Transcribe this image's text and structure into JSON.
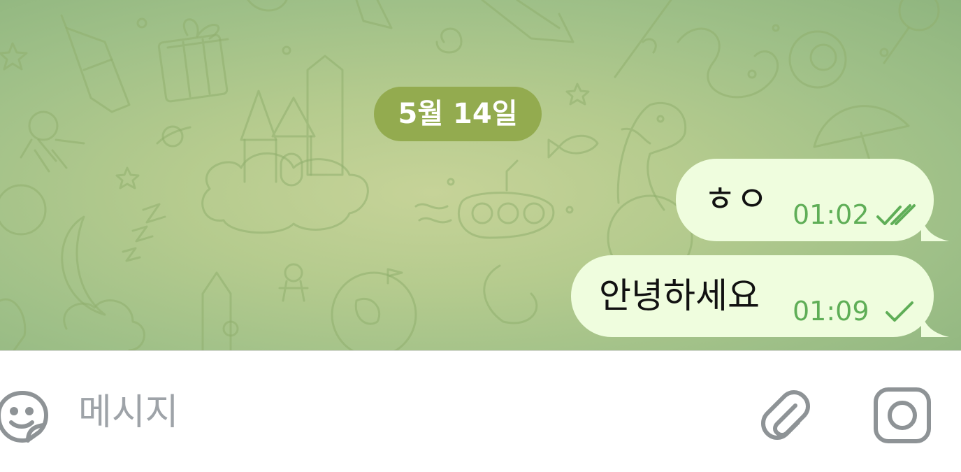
{
  "chat": {
    "date_label": "5월 14일",
    "messages": [
      {
        "text": "ㅎㅇ",
        "time": "01:02",
        "status_icon": "double-check-icon"
      },
      {
        "text": "안녕하세요",
        "time": "01:09",
        "status_icon": "single-check-icon"
      }
    ]
  },
  "input": {
    "placeholder": "메시지",
    "value": ""
  },
  "icons": {
    "emoji": "sticker-smile-icon",
    "attach": "paperclip-icon",
    "camera": "camera-icon"
  },
  "colors": {
    "date_pill": "#93ab4f",
    "bubble": "#effdde",
    "time_text": "#5fae57",
    "placeholder": "#9ea3a8",
    "icon_gray": "#8e9396"
  }
}
